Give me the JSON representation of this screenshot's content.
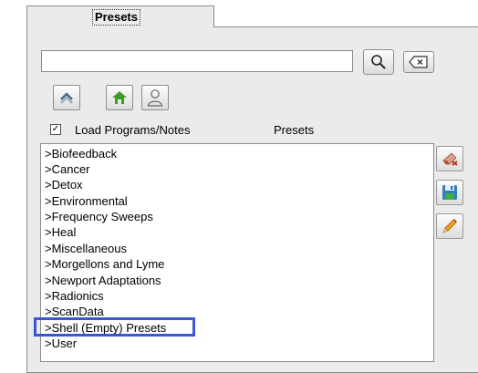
{
  "tab": {
    "label": "Presets"
  },
  "search": {
    "value": ""
  },
  "options": {
    "load_checked": true,
    "check_mark": "✓",
    "load_label": "Load Programs/Notes",
    "presets_label": "Presets"
  },
  "icons": {
    "search": "magnifier-icon",
    "clear": "backspace-clear-icon",
    "up": "chevron-up-icon",
    "home": "home-icon",
    "user": "user-icon",
    "delete": "erase-icon",
    "save": "save-disk-icon",
    "edit": "pencil-icon"
  },
  "colors": {
    "home_green": "#3f9a2a",
    "highlight_border": "#3a56d4"
  },
  "list": {
    "items": [
      ">Biofeedback",
      ">Cancer",
      ">Detox",
      ">Environmental",
      ">Frequency Sweeps",
      ">Heal",
      ">Miscellaneous",
      ">Morgellons and Lyme",
      ">Newport Adaptations",
      ">Radionics",
      ">ScanData",
      ">Shell (Empty) Presets",
      ">User"
    ],
    "highlighted_index": 11
  }
}
